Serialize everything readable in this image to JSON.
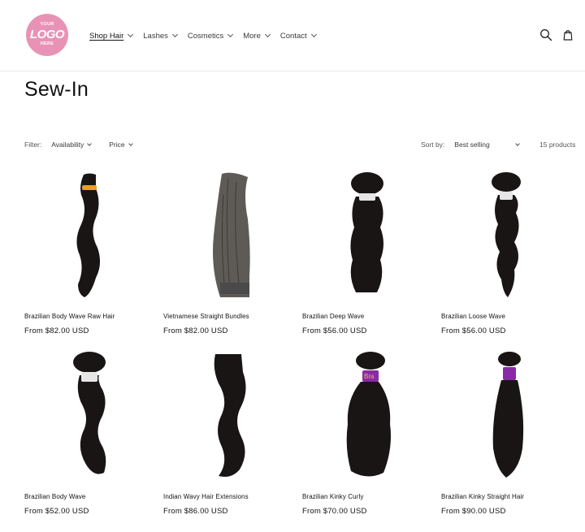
{
  "logo": {
    "line1": "YOUR",
    "line2": "LOGO",
    "line3": "HERE"
  },
  "nav": [
    {
      "label": "Shop Hair"
    },
    {
      "label": "Lashes"
    },
    {
      "label": "Cosmetics"
    },
    {
      "label": "More"
    },
    {
      "label": "Contact"
    }
  ],
  "title": "Sew-In",
  "filter": {
    "label": "Filter:",
    "availability": "Availability",
    "price": "Price"
  },
  "sort": {
    "label": "Sort by:",
    "selected": "Best selling"
  },
  "count": "15 products",
  "products": [
    {
      "name": "Brazilian Body Wave Raw Hair",
      "price": "From $82.00 USD",
      "band_color": "#e8a020",
      "label": ""
    },
    {
      "name": "Vietnamese Straight Bundles",
      "price": "From $82.00 USD",
      "band_color": "#4a4a4a",
      "label": ""
    },
    {
      "name": "Brazilian Deep Wave",
      "price": "From $56.00 USD",
      "band_color": "#e6e6e6",
      "label": ""
    },
    {
      "name": "Brazilian Loose Wave",
      "price": "From $56.00 USD",
      "band_color": "#e6e6e6",
      "label": ""
    },
    {
      "name": "Brazilian Body Wave",
      "price": "From $52.00 USD",
      "band_color": "#e6e6e6",
      "label": ""
    },
    {
      "name": "Indian Wavy Hair Extensions",
      "price": "From $86.00 USD",
      "band_color": "#1a1515",
      "label": ""
    },
    {
      "name": "Brazilian Kinky Curly",
      "price": "From $70.00 USD",
      "band_color": "#8a2aa8",
      "label": "Bra"
    },
    {
      "name": "Brazilian Kinky Straight Hair",
      "price": "From $90.00 USD",
      "band_color": "#8a2aa8",
      "label": ""
    }
  ],
  "colors": {
    "hair": "#1a1515",
    "hair_grey": "#5e5a56",
    "logo_bg": "#e893b6"
  }
}
